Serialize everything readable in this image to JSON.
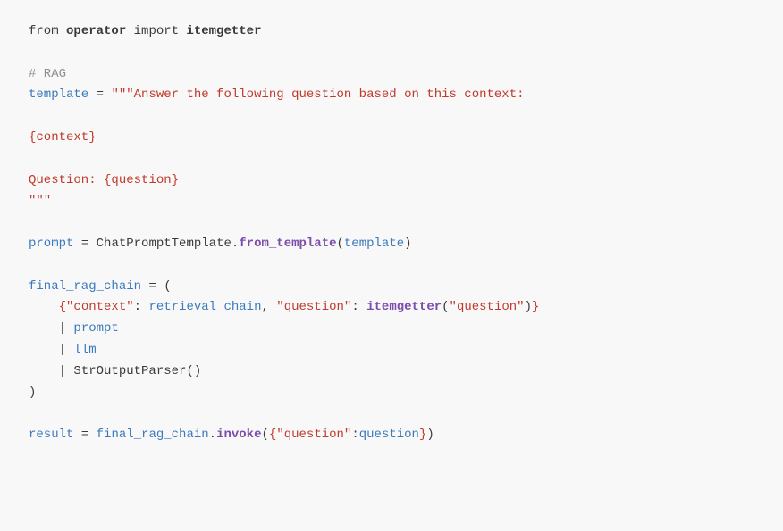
{
  "code": {
    "lines": [
      {
        "id": "line1",
        "type": "code"
      },
      {
        "id": "blank1",
        "type": "blank"
      },
      {
        "id": "comment_rag",
        "type": "code"
      },
      {
        "id": "template_assign",
        "type": "code"
      },
      {
        "id": "template_body1",
        "type": "code"
      },
      {
        "id": "blank2",
        "type": "blank"
      },
      {
        "id": "template_context",
        "type": "code"
      },
      {
        "id": "blank3",
        "type": "blank"
      },
      {
        "id": "template_question",
        "type": "code"
      },
      {
        "id": "template_close",
        "type": "code"
      },
      {
        "id": "blank4",
        "type": "blank"
      },
      {
        "id": "prompt_assign",
        "type": "code"
      },
      {
        "id": "blank5",
        "type": "blank"
      },
      {
        "id": "final_rag_line1",
        "type": "code"
      },
      {
        "id": "final_rag_line2",
        "type": "code"
      },
      {
        "id": "final_rag_line3",
        "type": "code"
      },
      {
        "id": "final_rag_line4",
        "type": "code"
      },
      {
        "id": "final_rag_line5",
        "type": "code"
      },
      {
        "id": "final_rag_line6",
        "type": "code"
      },
      {
        "id": "blank6",
        "type": "blank"
      },
      {
        "id": "result_line",
        "type": "code"
      }
    ]
  }
}
